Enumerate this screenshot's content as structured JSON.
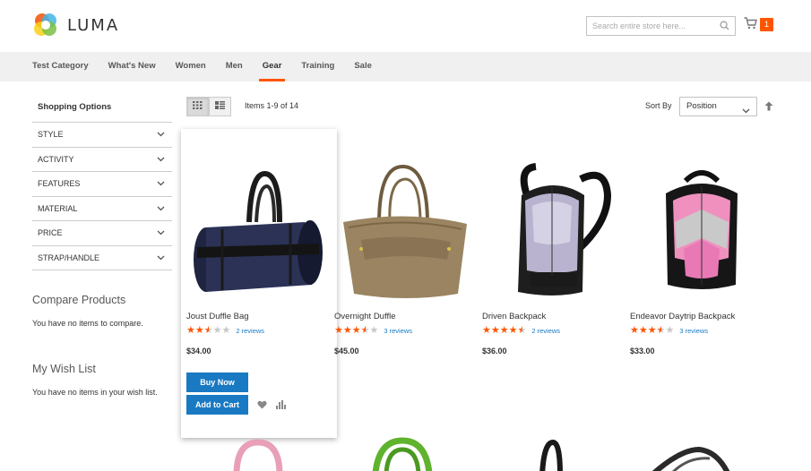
{
  "header": {
    "logo_text": "LUMA",
    "search_placeholder": "Search entire store here...",
    "cart_count": "1"
  },
  "nav": {
    "items": [
      {
        "label": "Test Category"
      },
      {
        "label": "What's New"
      },
      {
        "label": "Women"
      },
      {
        "label": "Men"
      },
      {
        "label": "Gear",
        "active": true
      },
      {
        "label": "Training"
      },
      {
        "label": "Sale"
      }
    ]
  },
  "sidebar": {
    "title": "Shopping Options",
    "filters": [
      "STYLE",
      "ACTIVITY",
      "FEATURES",
      "MATERIAL",
      "PRICE",
      "STRAP/HANDLE"
    ],
    "compare_title": "Compare Products",
    "compare_empty": "You have no items to compare.",
    "wishlist_title": "My Wish List",
    "wishlist_empty": "You have no items in your wish list."
  },
  "toolbar": {
    "amount": "Items 1-9 of 14",
    "sort_label": "Sort By",
    "sort_value": "Position"
  },
  "products": [
    {
      "name": "Joust Duffle Bag",
      "rating": 2.5,
      "reviews": "2 reviews",
      "price": "$34.00"
    },
    {
      "name": "Overnight Duffle",
      "rating": 3.5,
      "reviews": "3 reviews",
      "price": "$45.00"
    },
    {
      "name": "Driven Backpack",
      "rating": 4.5,
      "reviews": "2 reviews",
      "price": "$36.00"
    },
    {
      "name": "Endeavor Daytrip Backpack",
      "rating": 3.5,
      "reviews": "3 reviews",
      "price": "$33.00"
    }
  ],
  "buttons": {
    "buy_now": "Buy Now",
    "add_to_cart": "Add to Cart"
  },
  "colors": {
    "accent": "#ff5501",
    "primary_button": "#1979c3",
    "link": "#1979c3"
  }
}
